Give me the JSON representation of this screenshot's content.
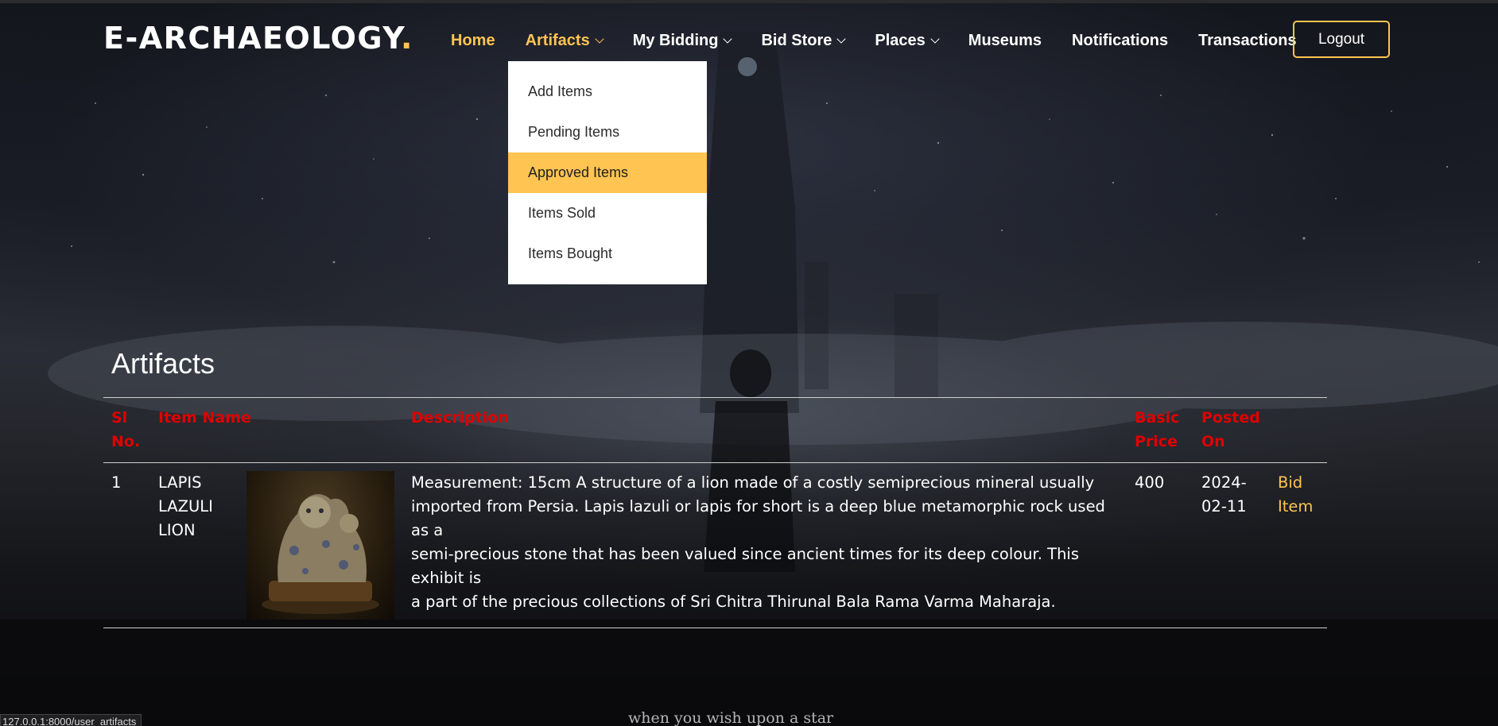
{
  "header": {
    "logo_text": "E-ARCHAEOLOGY",
    "logo_dot": ".",
    "nav": [
      {
        "label": "Home",
        "active": true,
        "has_dropdown": false
      },
      {
        "label": "Artifacts",
        "active": true,
        "has_dropdown": true
      },
      {
        "label": "My Bidding",
        "active": false,
        "has_dropdown": true
      },
      {
        "label": "Bid Store",
        "active": false,
        "has_dropdown": true
      },
      {
        "label": "Places",
        "active": false,
        "has_dropdown": true
      },
      {
        "label": "Museums",
        "active": false,
        "has_dropdown": false
      },
      {
        "label": "Notifications",
        "active": false,
        "has_dropdown": false
      },
      {
        "label": "Transactions",
        "active": false,
        "has_dropdown": false
      }
    ],
    "logout_label": "Logout"
  },
  "artifacts_menu": {
    "items": [
      "Add Items",
      "Pending Items",
      "Approved Items",
      "Items Sold",
      "Items Bought"
    ],
    "selected": "Approved Items"
  },
  "main": {
    "title": "Artifacts",
    "columns": {
      "sl_no_1": "Sl",
      "sl_no_2": "No.",
      "item_name": "Item Name",
      "description": "Description",
      "basic_price_1": "Basic",
      "basic_price_2": "Price",
      "posted_on_1": "Posted",
      "posted_on_2": "On"
    },
    "rows": [
      {
        "sl_no": "1",
        "item_name_1": "LAPIS",
        "item_name_2": "LAZULI",
        "item_name_3": "LION",
        "description_1": "Measurement: 15cm A structure of a lion made of a costly semiprecious mineral usually",
        "description_2": "imported from Persia. Lapis lazuli or lapis for short is a deep blue metamorphic rock used as a",
        "description_3": "semi-precious stone that has been valued since ancient times for its deep colour. This exhibit is",
        "description_4": "a part of the precious collections of Sri Chitra Thirunal Bala Rama Varma Maharaja.",
        "basic_price": "400",
        "posted_on_1": "2024-",
        "posted_on_2": "02-11",
        "action_1": "Bid",
        "action_2": "Item"
      }
    ]
  },
  "status_bar": {
    "url": "127.0.0.1:8000/user_artifacts"
  },
  "background_caption": "when you wish upon a star",
  "colors": {
    "accent": "#ffc451",
    "header_red": "#e00000",
    "text": "#ffffff"
  },
  "icons": [
    "chevron-down-icon"
  ]
}
